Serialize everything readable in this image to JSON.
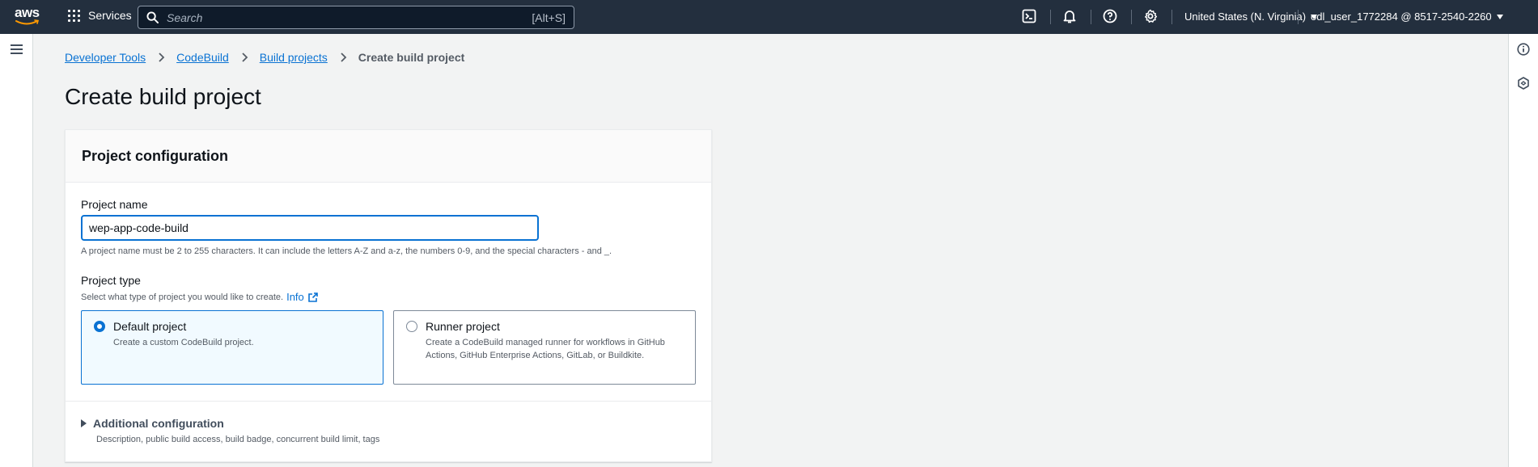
{
  "topnav": {
    "logo_text": "aws",
    "services_label": "Services",
    "search_placeholder": "Search",
    "search_shortcut": "[Alt+S]",
    "region_label": "United States (N. Virginia)",
    "account_label": "odl_user_1772284 @ 8517-2540-2260",
    "icons": [
      "cloudshell-icon",
      "notifications-icon",
      "help-icon",
      "settings-icon"
    ]
  },
  "breadcrumb": {
    "items": [
      "Developer Tools",
      "CodeBuild",
      "Build projects"
    ],
    "current": "Create build project"
  },
  "page": {
    "title": "Create build project"
  },
  "project_config": {
    "heading": "Project configuration",
    "name_label": "Project name",
    "name_value": "wep-app-code-build",
    "name_hint": "A project name must be 2 to 255 characters. It can include the letters A-Z and a-z, the numbers 0-9, and the special characters - and _.",
    "type_label": "Project type",
    "type_hint": "Select what type of project you would like to create.",
    "info_link": "Info",
    "options": [
      {
        "title": "Default project",
        "desc": "Create a custom CodeBuild project.",
        "selected": true
      },
      {
        "title": "Runner project",
        "desc": "Create a CodeBuild managed runner for workflows in GitHub Actions, GitHub Enterprise Actions, GitLab, or Buildkite.",
        "selected": false
      }
    ],
    "additional_title": "Additional configuration",
    "additional_desc": "Description, public build access, build badge, concurrent build limit, tags"
  },
  "colors": {
    "nav_bg": "#232f3e",
    "accent": "#0972d3",
    "page_bg": "#f2f3f3"
  }
}
